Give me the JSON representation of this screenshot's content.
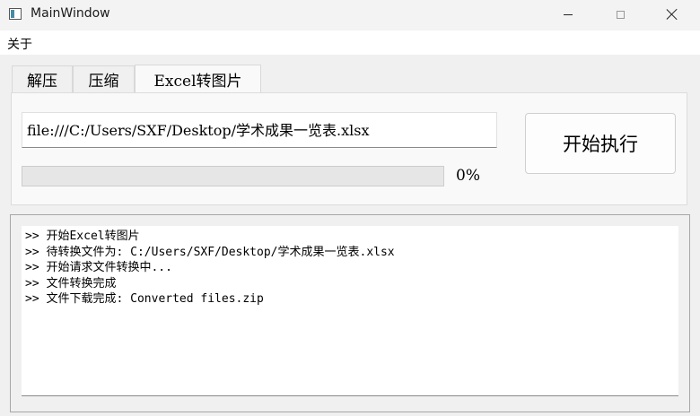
{
  "window": {
    "title": "MainWindow",
    "icon": "app-window-icon",
    "controls": {
      "minimize": "minimize-icon",
      "maximize": "maximize-icon",
      "close": "close-icon"
    }
  },
  "menubar": {
    "items": [
      {
        "label": "关于"
      }
    ]
  },
  "tabs": [
    {
      "label": "解压",
      "active": false
    },
    {
      "label": "压缩",
      "active": false
    },
    {
      "label": "Excel转图片",
      "active": true
    }
  ],
  "form": {
    "file_path": "file:///C:/Users/SXF/Desktop/学术成果一览表.xlsx",
    "progress_fraction": 0.0,
    "progress_text": "0%",
    "start_button_label": "开始执行",
    "progress_color": "#06b025"
  },
  "log": {
    "lines": [
      ">> 开始Excel转图片",
      ">> 待转换文件为: C:/Users/SXF/Desktop/学术成果一览表.xlsx",
      ">> 开始请求文件转换中...",
      ">> 文件转换完成",
      ">> 文件下载完成: Converted files.zip"
    ]
  }
}
